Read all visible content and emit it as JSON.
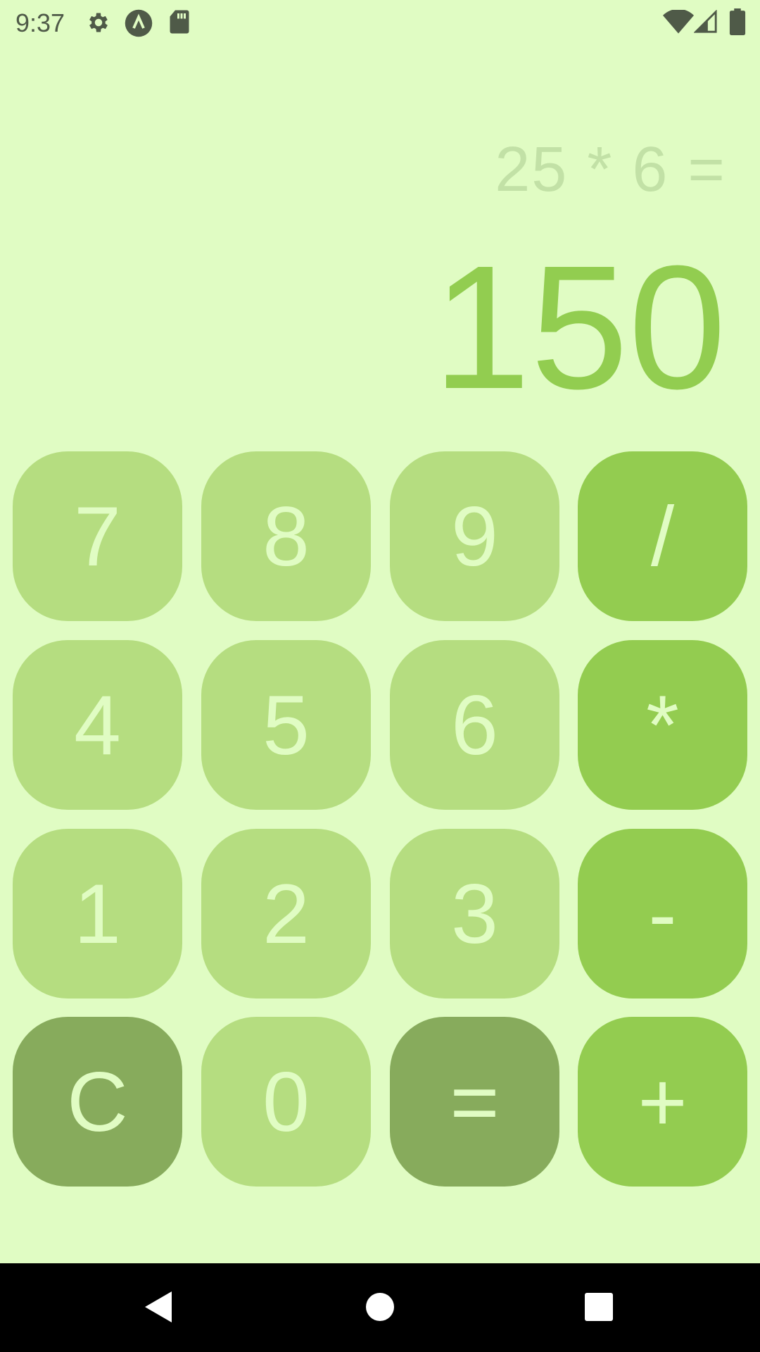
{
  "status_bar": {
    "time": "9:37",
    "left_icons": [
      "gear-icon",
      "a-circle-icon",
      "sd-card-icon"
    ],
    "right_icons": [
      "wifi-icon",
      "signal-icon",
      "battery-icon"
    ]
  },
  "display": {
    "expression": "25 * 6 =",
    "result": "150"
  },
  "keypad": {
    "keys": [
      {
        "label": "7",
        "kind": "digit"
      },
      {
        "label": "8",
        "kind": "digit"
      },
      {
        "label": "9",
        "kind": "digit"
      },
      {
        "label": "/",
        "kind": "operator"
      },
      {
        "label": "4",
        "kind": "digit"
      },
      {
        "label": "5",
        "kind": "digit"
      },
      {
        "label": "6",
        "kind": "digit"
      },
      {
        "label": "*",
        "kind": "operator"
      },
      {
        "label": "1",
        "kind": "digit"
      },
      {
        "label": "2",
        "kind": "digit"
      },
      {
        "label": "3",
        "kind": "digit"
      },
      {
        "label": "-",
        "kind": "operator"
      },
      {
        "label": "C",
        "kind": "function"
      },
      {
        "label": "0",
        "kind": "digit"
      },
      {
        "label": "=",
        "kind": "function"
      },
      {
        "label": "+",
        "kind": "operator"
      }
    ]
  },
  "colors": {
    "background": "#e0fcc3",
    "digit_key": "#b5dd80",
    "operator_key": "#93cc50",
    "function_key": "#87ab5c",
    "result_text": "#92cd50",
    "expression_text": "#c2e1a6"
  },
  "nav_bar": {
    "icons": [
      "back-icon",
      "home-icon",
      "recents-icon"
    ]
  }
}
